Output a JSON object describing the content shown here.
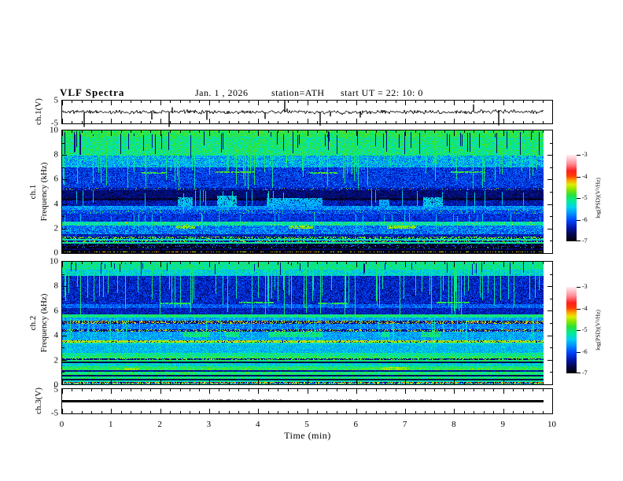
{
  "title": {
    "main": "VLF  Spectra",
    "date": "Jan. 1  , 2026",
    "station": "station=ATH",
    "start_ut": "start UT  =   22: 10: 0"
  },
  "axes": {
    "time_label": "Time  (min)",
    "time_ticks": [
      "0",
      "1",
      "2",
      "3",
      "4",
      "5",
      "6",
      "7",
      "8",
      "9",
      "10"
    ],
    "freq_ticks": [
      "10",
      "8",
      "6",
      "4",
      "2",
      "0"
    ],
    "volt_ticks": [
      "5",
      "-5"
    ]
  },
  "panel_labels": {
    "wave1": "ch.1(V)",
    "spec1_ch": "ch.1",
    "spec1_axis": "Frequency  (kHz)",
    "spec2_ch": "ch.2",
    "spec2_axis": "Frequency  (kHz)",
    "wave3": "ch.3(V)"
  },
  "colorbar": {
    "label": "log(PSD)(V²/Hz)",
    "ticks": [
      "-3",
      "-4",
      "-5",
      "-6",
      "-7"
    ],
    "value_range": [
      -7,
      -3
    ]
  },
  "chart_data": [
    {
      "name": "ch1_waveform",
      "type": "line",
      "ylabel": "ch.1(V)",
      "ylim": [
        -5,
        5
      ],
      "xlim_min": [
        0,
        10
      ],
      "data_extent_min": 9.8,
      "description": "noisy signal near 0 V, ~±0.5 V band with many impulsive spikes reaching ±5 V",
      "seed": 11,
      "noise_v": 0.5,
      "spike_down_prob": 0.02,
      "spike_up_prob": 0.012,
      "spike_max_v": 5.5
    },
    {
      "name": "ch1_spectrogram",
      "type": "heatmap",
      "ylabel": "ch.1  Frequency (kHz)",
      "ylim": [
        0,
        10
      ],
      "xlim_min": [
        0,
        10
      ],
      "data_extent_min": 9.8,
      "zlabel": "log(PSD)(V²/Hz)",
      "zlim": [
        -7,
        -3
      ],
      "seed": 77,
      "bands": [
        [
          9.5,
          10.01,
          -4.9,
          0.25,
          0,
          0,
          0
        ],
        [
          8.0,
          9.5,
          -5.05,
          0.35,
          0,
          0,
          0
        ],
        [
          7.0,
          8.0,
          -5.55,
          0.45,
          0,
          0,
          0
        ],
        [
          5.35,
          7.0,
          -6.1,
          0.35,
          0,
          0,
          0
        ],
        [
          5.15,
          5.35,
          -6.35,
          0.3,
          0.06,
          -4.6,
          0.3
        ],
        [
          4.55,
          5.15,
          -6.55,
          0.25,
          0,
          0,
          0
        ],
        [
          4.3,
          4.55,
          -6.75,
          0.2,
          0,
          0,
          0
        ],
        [
          3.85,
          4.3,
          -6.35,
          0.3,
          0,
          0,
          0
        ],
        [
          3.55,
          3.85,
          -5.7,
          0.35,
          0,
          0,
          0
        ],
        [
          3.25,
          3.55,
          -6.0,
          0.35,
          0.08,
          -4.9,
          0.3
        ],
        [
          2.6,
          3.25,
          -6.15,
          0.3,
          0,
          0,
          0
        ],
        [
          2.3,
          2.6,
          -5.2,
          0.35,
          0.05,
          -4.5,
          0.3
        ],
        [
          2.0,
          2.3,
          -5.8,
          0.4,
          0,
          0,
          0
        ],
        [
          1.55,
          2.0,
          -5.8,
          0.45,
          0,
          0,
          0
        ],
        [
          1.4,
          1.55,
          -6.3,
          0.3,
          0,
          0,
          0
        ],
        [
          1.2,
          1.4,
          -6.5,
          0.3,
          0.45,
          -4.75,
          0.35
        ],
        [
          1.05,
          1.2,
          -5.3,
          0.35,
          0,
          0,
          0
        ],
        [
          0.92,
          1.05,
          -6.4,
          0.3,
          0.3,
          -4.5,
          0.3
        ],
        [
          0.78,
          0.92,
          -5.15,
          0.3,
          0,
          0,
          0
        ],
        [
          0.55,
          0.78,
          -6.8,
          0.2,
          0.12,
          -5.9,
          0.3
        ],
        [
          0.4,
          0.55,
          -6.9,
          0.12,
          0.06,
          -5.2,
          0.4
        ],
        [
          0.28,
          0.4,
          -6.6,
          0.3,
          0,
          0,
          0
        ],
        [
          0.18,
          0.28,
          -6.9,
          0.1,
          0,
          0,
          0
        ],
        [
          0.08,
          0.18,
          -6.8,
          0.15,
          0.4,
          -4.3,
          0.3
        ],
        [
          0.0,
          0.08,
          -6.9,
          0.1,
          0,
          0,
          0
        ]
      ],
      "streaks": [
        {
          "f0": 7.8,
          "f1": 10,
          "prob": 0.08,
          "level": -6.5,
          "dark": true,
          "vary": 0.5
        },
        {
          "f0": 5.2,
          "f1": 9.8,
          "prob": 0.1,
          "level": -5.05,
          "dark": false,
          "vary": 0.55
        },
        {
          "f0": 3.3,
          "f1": 5.2,
          "prob": 0.05,
          "level": -5.4,
          "dark": false,
          "vary": 0.5
        },
        {
          "f0": 1.5,
          "f1": 3.3,
          "prob": 0.04,
          "level": -5.5,
          "dark": false,
          "vary": 0.5
        }
      ],
      "patches": [
        {
          "t0": 2.35,
          "t1": 2.65,
          "f0": 3.8,
          "f1": 4.6,
          "level": -5.45
        },
        {
          "t0": 3.15,
          "t1": 3.55,
          "f0": 3.8,
          "f1": 4.7,
          "level": -5.45
        },
        {
          "t0": 4.15,
          "t1": 5.3,
          "f0": 3.9,
          "f1": 4.5,
          "level": -5.55
        },
        {
          "t0": 6.45,
          "t1": 6.65,
          "f0": 3.9,
          "f1": 4.4,
          "level": -5.6
        },
        {
          "t0": 7.35,
          "t1": 7.75,
          "f0": 3.8,
          "f1": 4.6,
          "level": -5.45
        },
        {
          "t0": 2.3,
          "t1": 2.7,
          "f0": 2.05,
          "f1": 2.3,
          "level": -4.6
        },
        {
          "t0": 4.6,
          "t1": 5.1,
          "f0": 2.05,
          "f1": 2.3,
          "level": -4.6
        },
        {
          "t0": 6.6,
          "t1": 7.2,
          "f0": 2.05,
          "f1": 2.3,
          "level": -4.6
        },
        {
          "t0": 1.6,
          "t1": 2.1,
          "f0": 6.5,
          "f1": 6.62,
          "level": -4.8
        },
        {
          "t0": 3.1,
          "t1": 3.9,
          "f0": 6.55,
          "f1": 6.67,
          "level": -4.8
        },
        {
          "t0": 5.0,
          "t1": 5.6,
          "f0": 6.5,
          "f1": 6.62,
          "level": -4.8
        },
        {
          "t0": 7.9,
          "t1": 8.6,
          "f0": 6.55,
          "f1": 6.67,
          "level": -4.8
        }
      ]
    },
    {
      "name": "ch2_spectrogram",
      "type": "heatmap",
      "ylabel": "ch.2  Frequency (kHz)",
      "ylim": [
        0,
        10
      ],
      "xlim_min": [
        0,
        10
      ],
      "data_extent_min": 9.8,
      "zlabel": "log(PSD)(V²/Hz)",
      "zlim": [
        -7,
        -3
      ],
      "seed": 131,
      "bands": [
        [
          9.4,
          10.01,
          -5.1,
          0.3,
          0,
          0,
          0
        ],
        [
          8.9,
          9.4,
          -5.35,
          0.35,
          0,
          0,
          0
        ],
        [
          6.6,
          8.9,
          -6.25,
          0.35,
          0,
          0,
          0
        ],
        [
          6.25,
          6.6,
          -5.9,
          0.35,
          0,
          0,
          0
        ],
        [
          5.75,
          6.25,
          -6.3,
          0.3,
          0,
          0,
          0
        ],
        [
          5.5,
          5.75,
          -5.05,
          0.3,
          0,
          0,
          0
        ],
        [
          5.25,
          5.5,
          -5.6,
          0.3,
          0,
          0,
          0
        ],
        [
          4.95,
          5.25,
          -6.5,
          0.25,
          0.35,
          -4.4,
          0.3
        ],
        [
          4.55,
          4.95,
          -5.75,
          0.35,
          0,
          0,
          0
        ],
        [
          4.35,
          4.55,
          -6.4,
          0.3,
          0.3,
          -4.5,
          0.3
        ],
        [
          3.65,
          4.35,
          -5.6,
          0.3,
          0,
          0,
          0
        ],
        [
          3.45,
          3.65,
          -4.5,
          0.3,
          0.15,
          -6.5,
          0.3
        ],
        [
          3.3,
          3.45,
          -5.3,
          0.25,
          0,
          0,
          0
        ],
        [
          2.6,
          3.3,
          -5.5,
          0.3,
          0,
          0,
          0
        ],
        [
          2.35,
          2.6,
          -5.1,
          0.3,
          0,
          0,
          0
        ],
        [
          2.15,
          2.35,
          -4.95,
          0.35,
          0,
          0,
          0
        ],
        [
          2.02,
          2.15,
          -6.5,
          0.3,
          0.3,
          -4.8,
          0.3
        ],
        [
          1.88,
          2.02,
          -5.0,
          0.3,
          0,
          0,
          0
        ],
        [
          1.78,
          1.88,
          -6.7,
          0.2,
          0,
          0,
          0
        ],
        [
          1.5,
          1.78,
          -5.35,
          0.35,
          0,
          0,
          0
        ],
        [
          1.35,
          1.5,
          -5.0,
          0.3,
          0,
          0,
          0
        ],
        [
          1.18,
          1.35,
          -4.9,
          0.35,
          0,
          0,
          0
        ],
        [
          1.05,
          1.18,
          -6.4,
          0.3,
          0,
          0,
          0
        ],
        [
          0.82,
          1.05,
          -5.0,
          0.3,
          0,
          0,
          0
        ],
        [
          0.7,
          0.82,
          -6.6,
          0.25,
          0,
          0,
          0
        ],
        [
          0.48,
          0.7,
          -5.05,
          0.3,
          0,
          0,
          0
        ],
        [
          0.36,
          0.48,
          -6.7,
          0.2,
          0,
          0,
          0
        ],
        [
          0.22,
          0.36,
          -5.2,
          0.3,
          0,
          0,
          0
        ],
        [
          0.12,
          0.22,
          -6.4,
          0.2,
          0.5,
          -4.25,
          0.25
        ],
        [
          0.0,
          0.12,
          -5.3,
          0.3,
          0,
          0,
          0
        ]
      ],
      "streaks": [
        {
          "f0": 8.9,
          "f1": 10,
          "prob": 0.05,
          "level": -6.4,
          "dark": true,
          "vary": 0.5
        },
        {
          "f0": 5.6,
          "f1": 10,
          "prob": 0.11,
          "level": -5.1,
          "dark": false,
          "vary": 0.55
        },
        {
          "f0": 2.5,
          "f1": 5.6,
          "prob": 0.05,
          "level": -5.3,
          "dark": false,
          "vary": 0.5
        }
      ],
      "patches": [
        {
          "t0": 2.45,
          "t1": 3.0,
          "f0": 3.85,
          "f1": 4.35,
          "level": -5.0
        },
        {
          "t0": 3.3,
          "t1": 3.6,
          "f0": 3.85,
          "f1": 4.35,
          "level": -5.0
        },
        {
          "t0": 4.2,
          "t1": 5.3,
          "f0": 3.9,
          "f1": 4.35,
          "level": -5.05
        },
        {
          "t0": 6.5,
          "t1": 6.65,
          "f0": 3.9,
          "f1": 4.3,
          "level": -5.1
        },
        {
          "t0": 7.3,
          "t1": 7.7,
          "f0": 3.85,
          "f1": 4.35,
          "level": -5.0
        },
        {
          "t0": 6.5,
          "t1": 7.0,
          "f0": 1.2,
          "f1": 1.45,
          "level": -4.55
        },
        {
          "t0": 1.25,
          "t1": 1.55,
          "f0": 1.2,
          "f1": 1.4,
          "level": -4.55
        },
        {
          "t0": 2.0,
          "t1": 2.6,
          "f0": 6.6,
          "f1": 6.72,
          "level": -4.9
        },
        {
          "t0": 3.6,
          "t1": 4.3,
          "f0": 6.65,
          "f1": 6.77,
          "level": -4.9
        },
        {
          "t0": 5.2,
          "t1": 5.8,
          "f0": 6.6,
          "f1": 6.72,
          "level": -4.9
        },
        {
          "t0": 7.6,
          "t1": 8.3,
          "f0": 6.65,
          "f1": 6.77,
          "level": -4.9
        }
      ]
    },
    {
      "name": "ch3_waveform",
      "type": "line",
      "ylabel": "ch.3(V)",
      "ylim": [
        -5,
        5
      ],
      "xlim_min": [
        0,
        10
      ],
      "data_extent_min": 9.8,
      "description": "flat thick trace at 0 V (dead/unused channel)",
      "seed": 5,
      "value_v": 0,
      "fuzz_segments_min": [
        [
          0.5,
          2.2
        ],
        [
          2.8,
          4.5
        ],
        [
          5.4,
          6.1
        ],
        [
          6.4,
          7.6
        ]
      ]
    }
  ],
  "colormap_stops": [
    [
      0.0,
      0,
      0,
      0
    ],
    [
      0.08,
      5,
      5,
      70
    ],
    [
      0.16,
      0,
      20,
      170
    ],
    [
      0.25,
      0,
      70,
      255
    ],
    [
      0.33,
      0,
      150,
      255
    ],
    [
      0.4,
      0,
      210,
      235
    ],
    [
      0.47,
      0,
      235,
      150
    ],
    [
      0.54,
      40,
      225,
      60
    ],
    [
      0.6,
      130,
      230,
      0
    ],
    [
      0.66,
      225,
      235,
      0
    ],
    [
      0.71,
      255,
      160,
      0
    ],
    [
      0.76,
      255,
      60,
      0
    ],
    [
      0.82,
      255,
      30,
      30
    ],
    [
      0.9,
      255,
      140,
      150
    ],
    [
      1.0,
      255,
      235,
      240
    ]
  ]
}
